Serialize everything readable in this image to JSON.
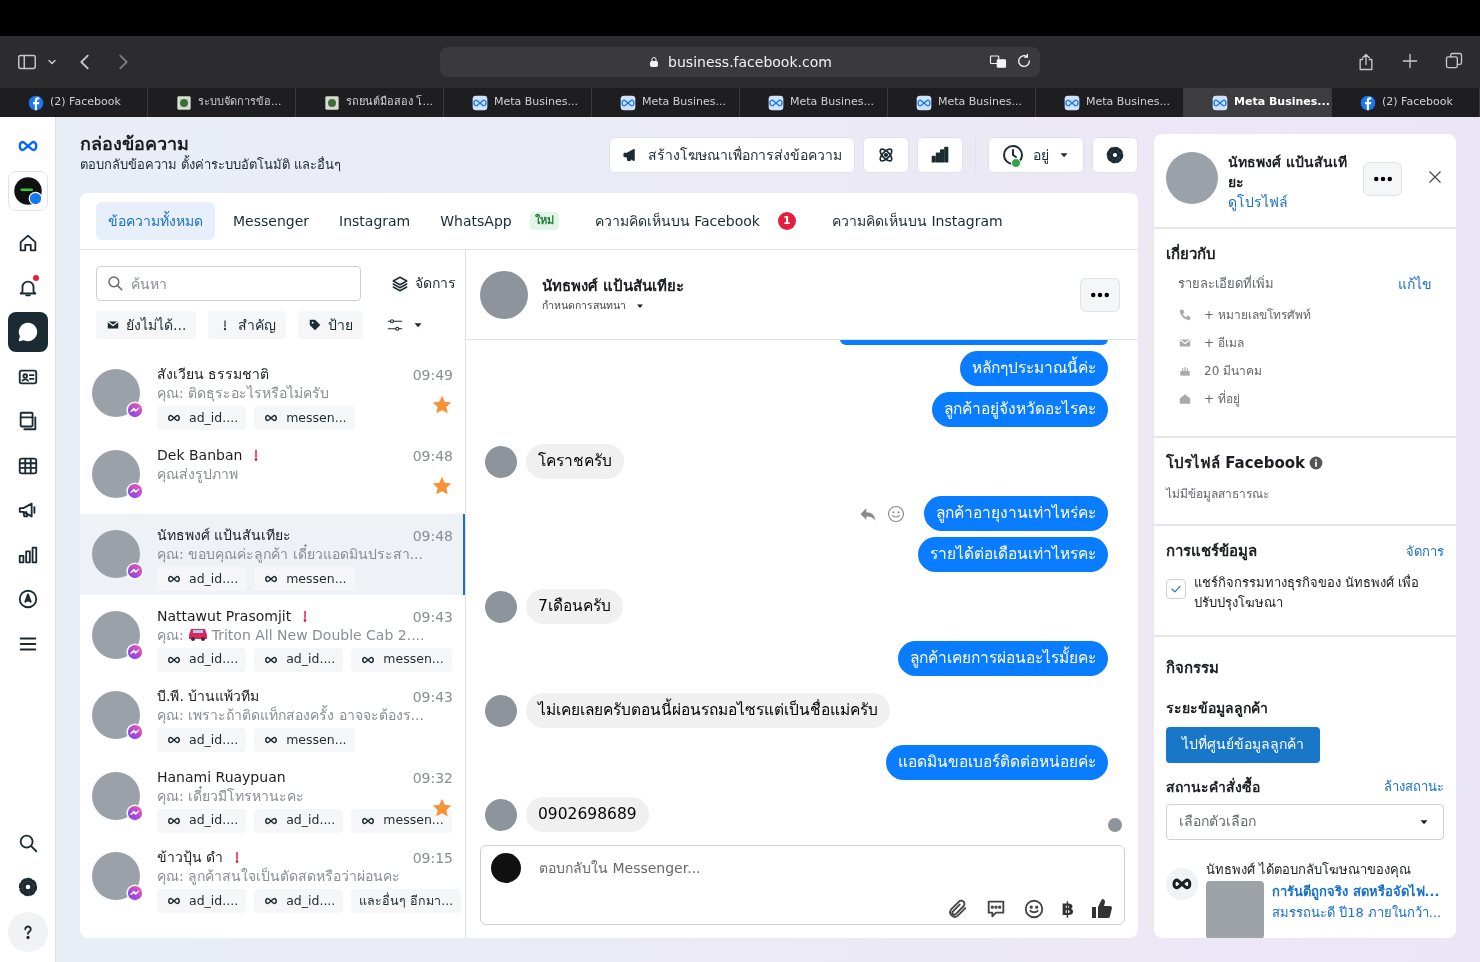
{
  "browser": {
    "url": "business.facebook.com",
    "tabs": [
      {
        "label": "(2) Facebook",
        "kind": "facebook",
        "selected": false
      },
      {
        "label": "ระบบจัดการข้อ...",
        "kind": "site",
        "selected": false
      },
      {
        "label": "รถยนต์มือสอง โ...",
        "kind": "site",
        "selected": false
      },
      {
        "label": "Meta Busines...",
        "kind": "meta",
        "selected": false
      },
      {
        "label": "Meta Busines...",
        "kind": "meta",
        "selected": false
      },
      {
        "label": "Meta Busines...",
        "kind": "meta",
        "selected": false
      },
      {
        "label": "Meta Busines...",
        "kind": "meta",
        "selected": false
      },
      {
        "label": "Meta Busines...",
        "kind": "meta",
        "selected": false
      },
      {
        "label": "Meta Busines...",
        "kind": "meta",
        "selected": true
      },
      {
        "label": "(2) Facebook",
        "kind": "facebook",
        "selected": false
      }
    ]
  },
  "nav": {
    "top": [
      {
        "kind": "home",
        "selected": false,
        "alert": false
      },
      {
        "kind": "bell",
        "selected": false,
        "alert": true
      },
      {
        "kind": "chat",
        "selected": true,
        "alert": false
      },
      {
        "kind": "contacts",
        "selected": false,
        "alert": false
      },
      {
        "kind": "pages",
        "selected": false,
        "alert": false
      },
      {
        "kind": "table",
        "selected": false,
        "alert": false
      },
      {
        "kind": "megaphone",
        "selected": false,
        "alert": false
      },
      {
        "kind": "chart",
        "selected": false,
        "alert": false
      },
      {
        "kind": "compass",
        "selected": false,
        "alert": false
      },
      {
        "kind": "menu",
        "selected": false,
        "alert": false
      }
    ],
    "bottom": [
      {
        "kind": "search",
        "selected": false,
        "alert": false
      },
      {
        "kind": "settings",
        "selected": false,
        "alert": false
      },
      {
        "kind": "help",
        "selected": false,
        "alert": false
      }
    ]
  },
  "header": {
    "title": "กล่องข้อความ",
    "subtitle": "ตอบกลับข้อความ ตั้งค่าระบบอัตโนมัติ และอื่นๆ",
    "create_ad_button": "สร้างโฆษณาเพื่อการส่งข้อความ",
    "status_label": "อยู่"
  },
  "inbox_tabs": [
    {
      "label": "ข้อความทั้งหมด",
      "selected": true
    },
    {
      "label": "Messenger",
      "selected": false
    },
    {
      "label": "Instagram",
      "selected": false
    },
    {
      "label": "WhatsApp",
      "selected": false,
      "tag": "ใหม่"
    },
    {
      "label": "ความคิดเห็นบน Facebook",
      "selected": false,
      "badge": "1"
    },
    {
      "label": "ความคิดเห็นบน Instagram",
      "selected": false
    }
  ],
  "list_tools": {
    "search_placeholder": "ค้นหา",
    "manage_label": "จัดการ",
    "filters": [
      {
        "kind": "unread",
        "label": "ยังไม่ได้..."
      },
      {
        "kind": "important",
        "label": "สำคัญ"
      },
      {
        "kind": "label",
        "label": "ป้าย"
      }
    ]
  },
  "conversations": [
    {
      "name": "สังเวียน ธรรมชาติ",
      "time": "09:49",
      "preview": "คุณ: ติดธุระอะไรหรือไม่ครับ",
      "flagged": false,
      "starred": true,
      "selected": false,
      "tags": [
        {
          "kind": "meta",
          "label": "ad_id...."
        },
        {
          "kind": "meta",
          "label": "messen..."
        }
      ]
    },
    {
      "name": "Dek Banban",
      "time": "09:48",
      "preview": "คุณส่งรูปภาพ",
      "flagged": true,
      "starred": true,
      "selected": false
    },
    {
      "name": "นัทธพงศ์ แป้นสันเทียะ",
      "time": "09:48",
      "preview": "คุณ: ขอบคุณค่ะลูกค้า เดี๋ยวแอดมินประสา...",
      "flagged": false,
      "starred": false,
      "selected": true,
      "tags": [
        {
          "kind": "meta",
          "label": "ad_id...."
        },
        {
          "kind": "meta",
          "label": "messen..."
        }
      ]
    },
    {
      "name": "Nattawut Prasomjit",
      "time": "09:43",
      "preview": "คุณ:",
      "car_icon": true,
      "preview_rest": "Triton All New Double Cab 2....",
      "flagged": true,
      "starred": false,
      "selected": false,
      "tags": [
        {
          "kind": "meta",
          "label": "ad_id...."
        },
        {
          "kind": "meta",
          "label": "ad_id...."
        },
        {
          "kind": "meta",
          "label": "messen..."
        }
      ]
    },
    {
      "name": "บี.พี. บ้านแพ้วทีม",
      "time": "09:43",
      "preview": "คุณ: เพราะถ้าติดแท็กสองครั้ง อาจจะต้องร...",
      "flagged": false,
      "starred": false,
      "selected": false,
      "tags": [
        {
          "kind": "meta",
          "label": "ad_id...."
        },
        {
          "kind": "meta",
          "label": "messen..."
        }
      ]
    },
    {
      "name": "Hanami Ruaypuan",
      "time": "09:32",
      "preview": "คุณ: เดี๋ยวมีโทรหานะคะ",
      "flagged": false,
      "starred": true,
      "selected": false,
      "tags": [
        {
          "kind": "meta",
          "label": "ad_id...."
        },
        {
          "kind": "meta",
          "label": "ad_id...."
        },
        {
          "kind": "meta",
          "label": "messen..."
        }
      ]
    },
    {
      "name": "ข้าวปุ้น ดำ",
      "time": "09:15",
      "preview": "คุณ: ลูกค้าสนใจเป็นตัดสดหรือว่าผ่อนคะ",
      "flagged": true,
      "starred": false,
      "selected": false,
      "tags": [
        {
          "kind": "meta",
          "label": "ad_id...."
        },
        {
          "kind": "meta",
          "label": "ad_id...."
        },
        {
          "kind": "more",
          "label": "และอื่นๆ อีกมา..."
        }
      ]
    }
  ],
  "chat": {
    "contact_name": "นัทธพงศ์ แป้นสันเทียะ",
    "subtitle": "กำหนดการสนทนา",
    "messages": [
      {
        "kind": "outgoing",
        "clipped": true
      },
      {
        "kind": "outgoing",
        "text": "หลักๆประมาณนี้ค่ะ"
      },
      {
        "kind": "outgoing",
        "text": "ลูกค้าอยู่จังหวัดอะไรคะ"
      },
      {
        "kind": "incoming",
        "text": "โคราชครับ"
      },
      {
        "kind": "outgoing",
        "text": "ลูกค้าอายุงานเท่าไหร่คะ",
        "hovered": true
      },
      {
        "kind": "outgoing",
        "text": "รายได้ต่อเดือนเท่าไหรคะ"
      },
      {
        "kind": "incoming",
        "text": "7เดือนครับ"
      },
      {
        "kind": "outgoing",
        "text": "ลูกค้าเคยการผ่อนอะไรมั้ยคะ"
      },
      {
        "kind": "incoming",
        "text": "ไม่เคยเลยครับตอนนี้ผ่อนรถมอไซรแต่เป็นชื่อแม่ครับ"
      },
      {
        "kind": "outgoing",
        "text": "แอดมินขอเบอร์ติดต่อหน่อยค่ะ"
      },
      {
        "kind": "incoming",
        "text": "0902698689",
        "seen": true
      }
    ],
    "composer_placeholder": "ตอบกลับใน Messenger...",
    "currency_symbol": "฿"
  },
  "profile": {
    "name": "นัทธพงศ์ แป้นสันเทียะ",
    "view_profile": "ดูโปรไฟล์",
    "about": {
      "title": "เกี่ยวกับ",
      "details_label": "รายละเอียดที่เพิ่ม",
      "edit": "แก้ไข",
      "details": [
        {
          "kind": "phone",
          "text": "+ หมายเลขโทรศัพท์"
        },
        {
          "kind": "email",
          "text": "+ อีเมล"
        },
        {
          "kind": "birthday",
          "text": "20 มีนาคม"
        },
        {
          "kind": "home",
          "text": "+ ที่อยู่"
        }
      ]
    },
    "facebook_profile": {
      "title": "โปรไฟล์ Facebook",
      "note": "ไม่มีข้อมูลสาธารณะ"
    },
    "sharing": {
      "title": "การแชร์ข้อมูล",
      "manage": "จัดการ",
      "checked": true,
      "label": "แชร์กิจกรรมทางธุรกิจของ นัทธพงศ์ เพื่อปรับปรุงโฆษณา"
    },
    "activity": {
      "title": "กิจกรรม",
      "stage_label": "ระยะข้อมูลลูกค้า",
      "stage_button": "ไปที่ศูนย์ข้อมูลลูกค้า",
      "order_label": "สถานะคำสั่งซื้อ",
      "clear": "ล้างสถานะ",
      "order_placeholder": "เลือกตัวเลือก",
      "event_text": "นัทธพงศ์ ได้ตอบกลับโฆษณาของคุณ",
      "ad_lines": [
        "การันตีถูกจริง สดหรือจัดไฟ...",
        "สมรรถนะดี ปี18 ภายในกว้า..."
      ]
    }
  }
}
